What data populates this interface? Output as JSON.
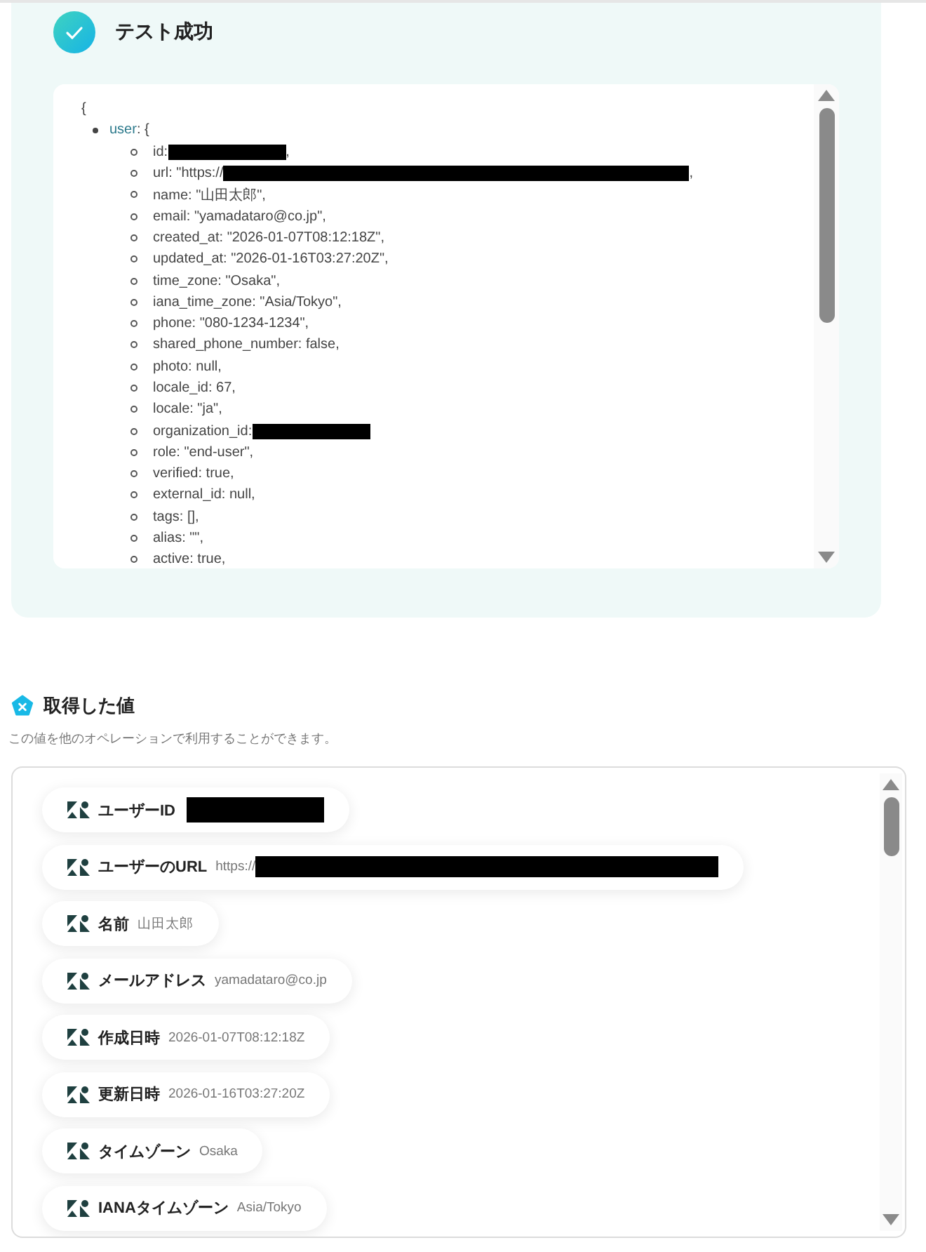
{
  "result": {
    "title": "テスト成功",
    "code": {
      "open": "{",
      "root_key": "user",
      "root_open": ": {",
      "lines": [
        {
          "text": "id:",
          "redacted": true,
          "after": ","
        },
        {
          "text": "url: \"https://",
          "redacted": true,
          "after": ","
        },
        {
          "text": "name: \"山田太郎\","
        },
        {
          "text": "email: \"yamadataro@co.jp\","
        },
        {
          "text": "created_at: \"2026-01-07T08:12:18Z\","
        },
        {
          "text": "updated_at: \"2026-01-16T03:27:20Z\","
        },
        {
          "text": "time_zone: \"Osaka\","
        },
        {
          "text": "iana_time_zone: \"Asia/Tokyo\","
        },
        {
          "text": "phone: \"080-1234-1234\","
        },
        {
          "text": "shared_phone_number: false,"
        },
        {
          "text": "photo: null,"
        },
        {
          "text": "locale_id: 67,"
        },
        {
          "text": "locale: \"ja\","
        },
        {
          "text": "organization_id:",
          "redacted": true
        },
        {
          "text": "role: \"end-user\","
        },
        {
          "text": "verified: true,"
        },
        {
          "text": "external_id: null,"
        },
        {
          "text": "tags: [],"
        },
        {
          "text": "alias: \"\","
        },
        {
          "text": "active: true,"
        }
      ]
    }
  },
  "values": {
    "title": "取得した値",
    "description": "この値を他のオペレーションで利用することができます。",
    "items": [
      {
        "label": "ユーザーID",
        "redacted": true
      },
      {
        "label": "ユーザーのURL",
        "value": "https://",
        "redacted": true
      },
      {
        "label": "名前",
        "value": "山田太郎"
      },
      {
        "label": "メールアドレス",
        "value": "yamadataro@co.jp"
      },
      {
        "label": "作成日時",
        "value": "2026-01-07T08:12:18Z"
      },
      {
        "label": "更新日時",
        "value": "2026-01-16T03:27:20Z"
      },
      {
        "label": "タイムゾーン",
        "value": "Osaka"
      },
      {
        "label": "IANAタイムゾーン",
        "value": "Asia/Tokyo"
      }
    ]
  }
}
